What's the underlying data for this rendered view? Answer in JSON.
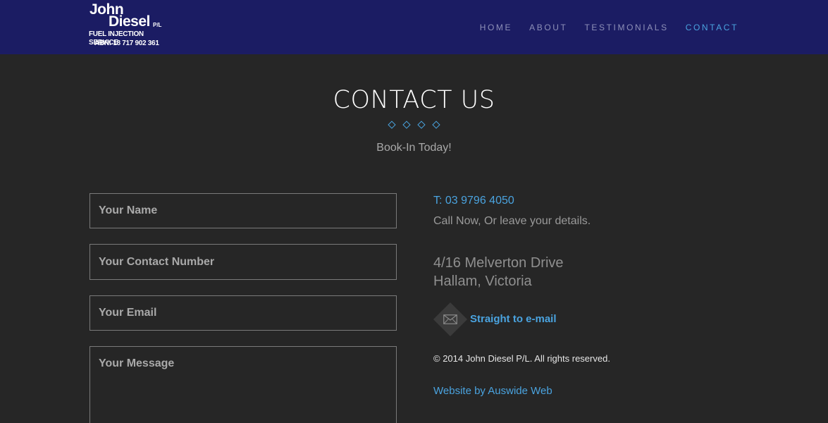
{
  "logo": {
    "line1": "John",
    "line2": "Diesel",
    "suffix": "P/L",
    "line3": "FUEL INJECTION SERVICE",
    "line4": "ABN: 18 717 902 361"
  },
  "nav": {
    "items": [
      {
        "label": "HOME"
      },
      {
        "label": "ABOUT"
      },
      {
        "label": "TESTIMONIALS"
      },
      {
        "label": "CONTACT",
        "active": true
      }
    ]
  },
  "page": {
    "title": "CONTACT US",
    "subtitle": "Book-In Today!"
  },
  "form": {
    "name_placeholder": "Your Name",
    "phone_placeholder": "Your Contact Number",
    "email_placeholder": "Your Email",
    "message_placeholder": "Your Message"
  },
  "contact": {
    "phone": "T: 03 9796 4050",
    "call_text": "Call Now, Or leave your details.",
    "address_line1": "4/16 Melverton Drive",
    "address_line2": "Hallam, Victoria",
    "email_link": "Straight to e-mail",
    "email_icon": "envelope-icon"
  },
  "footer": {
    "copyright": "© 2014 John Diesel P/L. All rights reserved.",
    "credit": "Website by Auswide Web"
  },
  "colors": {
    "header_bg": "#1b1c63",
    "page_bg": "#262626",
    "accent": "#4aa3df"
  }
}
